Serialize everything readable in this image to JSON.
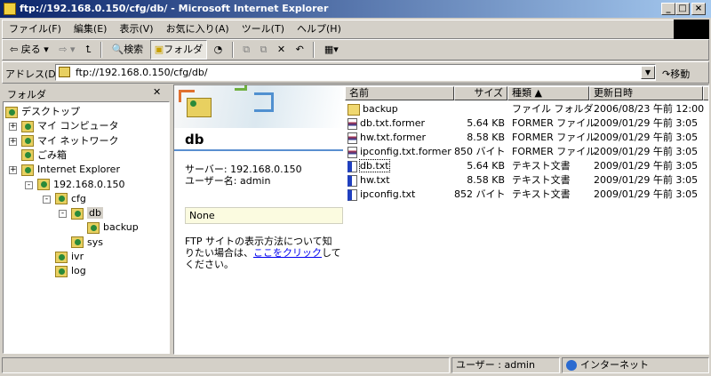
{
  "window": {
    "title": "ftp://192.168.0.150/cfg/db/ - Microsoft Internet Explorer",
    "minimize": "_",
    "maximize": "□",
    "close": "×"
  },
  "menu": [
    "ファイル(F)",
    "編集(E)",
    "表示(V)",
    "お気に入り(A)",
    "ツール(T)",
    "ヘルプ(H)"
  ],
  "toolbar": {
    "back": "⇦ 戻る ▾",
    "forward": "⇨ ▾",
    "up": "⮤",
    "search": "検索",
    "folders": "フォルダ",
    "history": "◔",
    "move": "⧉",
    "copy": "⧉",
    "delete": "✕",
    "undo": "↶",
    "views": "▦▾"
  },
  "address": {
    "label": "アドレス(D)",
    "value": "ftp://192.168.0.150/cfg/db/",
    "go": "↷移動"
  },
  "folder_pane": {
    "title": "フォルダ",
    "close": "✕",
    "tree": [
      {
        "label": "デスクトップ",
        "level": 0
      },
      {
        "label": "マイ コンピュータ",
        "level": 1,
        "exp": "+"
      },
      {
        "label": "マイ ネットワーク",
        "level": 1,
        "exp": "+"
      },
      {
        "label": "ごみ箱",
        "level": 1
      },
      {
        "label": "Internet Explorer",
        "level": 1,
        "exp": "+"
      },
      {
        "label": "192.168.0.150",
        "level": 2,
        "exp": "−"
      },
      {
        "label": "cfg",
        "level": 3,
        "exp": "−"
      },
      {
        "label": "db",
        "level": 4,
        "exp": "−",
        "selected": true
      },
      {
        "label": "backup",
        "level": 5
      },
      {
        "label": "sys",
        "level": 4
      },
      {
        "label": "ivr",
        "level": 3
      },
      {
        "label": "log",
        "level": 3
      }
    ]
  },
  "webview": {
    "folder": "db",
    "server": "サーバー: 192.168.0.150",
    "user": "ユーザー名: admin",
    "note": "None",
    "help_pre": "FTP サイトの表示方法について知りたい場合は、",
    "help_link": "ここをクリック",
    "help_post": "してください。"
  },
  "columns": {
    "name": "名前",
    "size": "サイズ",
    "type": "種類 ▲",
    "date": "更新日時"
  },
  "files": [
    {
      "name": "backup",
      "size": "",
      "type": "ファイル フォルダ",
      "date": "2006/08/23 午前 12:00",
      "icon": "folder-icon"
    },
    {
      "name": "db.txt.former",
      "size": "5.64 KB",
      "type": "FORMER ファイル",
      "date": "2009/01/29 午前 3:05",
      "icon": "file-icon"
    },
    {
      "name": "hw.txt.former",
      "size": "8.58 KB",
      "type": "FORMER ファイル",
      "date": "2009/01/29 午前 3:05",
      "icon": "file-icon"
    },
    {
      "name": "ipconfig.txt.former",
      "size": "850 バイト",
      "type": "FORMER ファイル",
      "date": "2009/01/29 午前 3:05",
      "icon": "file-icon"
    },
    {
      "name": "db.txt",
      "size": "5.64 KB",
      "type": "テキスト文書",
      "date": "2009/01/29 午前 3:05",
      "icon": "text-file-icon"
    },
    {
      "name": "hw.txt",
      "size": "8.58 KB",
      "type": "テキスト文書",
      "date": "2009/01/29 午前 3:05",
      "icon": "text-file-icon"
    },
    {
      "name": "ipconfig.txt",
      "size": "852 バイト",
      "type": "テキスト文書",
      "date": "2009/01/29 午前 3:05",
      "icon": "text-file-icon"
    }
  ],
  "status": {
    "user": "ユーザー : admin",
    "zone": "インターネット"
  }
}
